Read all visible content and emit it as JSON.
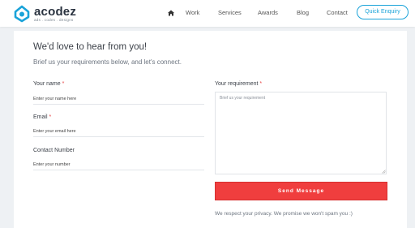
{
  "brand": {
    "name": "acodez",
    "tagline": "ads . codes . designs",
    "accent": "#1aa3d9"
  },
  "nav": {
    "home_icon": "home-icon",
    "items": [
      "Work",
      "Services",
      "Awards",
      "Blog",
      "Contact"
    ],
    "cta": "Quick Enquiry"
  },
  "form": {
    "title": "We'd love to hear from you!",
    "subtitle": "Brief us your requirements below, and let's connect.",
    "name": {
      "label": "Your name",
      "required": "*",
      "placeholder": "Enter your name here"
    },
    "email": {
      "label": "Email",
      "required": "*",
      "placeholder": "Enter your email here"
    },
    "phone": {
      "label": "Contact Number",
      "placeholder": "Enter your number"
    },
    "requirement": {
      "label": "Your requirement",
      "required": "*",
      "placeholder": "Brief us your requirement"
    },
    "submit": "Send Message",
    "privacy_note": "We respect your privacy. We promise we won't spam you :)",
    "submit_color": "#f03e3e"
  }
}
